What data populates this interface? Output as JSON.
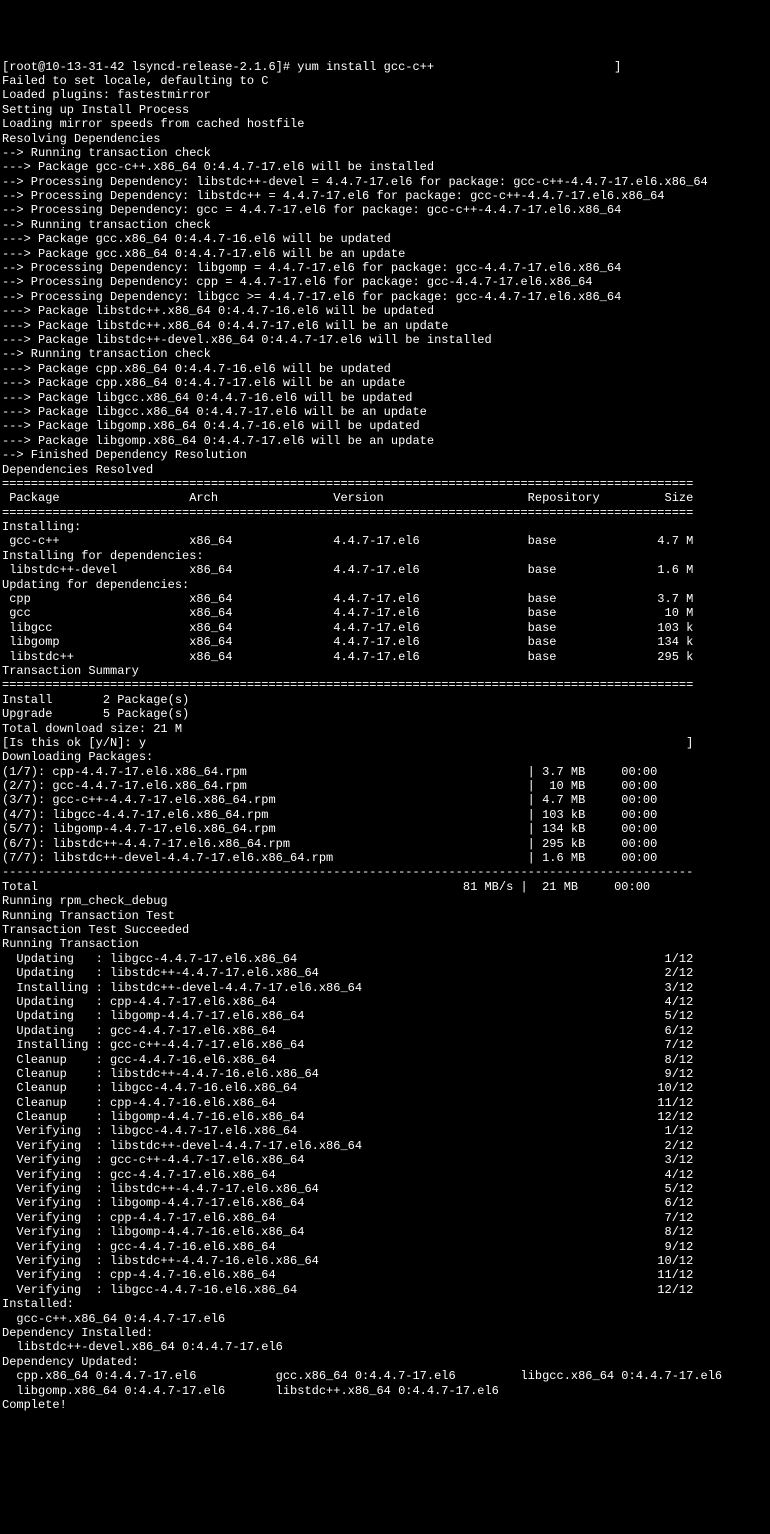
{
  "prompt": "[root@10-13-31-42 lsyncd-release-2.1.6]# yum install gcc-c++                         ]",
  "preLines": [
    "Failed to set locale, defaulting to C",
    "Loaded plugins: fastestmirror",
    "Setting up Install Process",
    "Loading mirror speeds from cached hostfile",
    "Resolving Dependencies",
    "--> Running transaction check",
    "---> Package gcc-c++.x86_64 0:4.4.7-17.el6 will be installed",
    "--> Processing Dependency: libstdc++-devel = 4.4.7-17.el6 for package: gcc-c++-4.4.7-17.el6.x86_64",
    "--> Processing Dependency: libstdc++ = 4.4.7-17.el6 for package: gcc-c++-4.4.7-17.el6.x86_64",
    "--> Processing Dependency: gcc = 4.4.7-17.el6 for package: gcc-c++-4.4.7-17.el6.x86_64",
    "--> Running transaction check",
    "---> Package gcc.x86_64 0:4.4.7-16.el6 will be updated",
    "---> Package gcc.x86_64 0:4.4.7-17.el6 will be an update",
    "--> Processing Dependency: libgomp = 4.4.7-17.el6 for package: gcc-4.4.7-17.el6.x86_64",
    "--> Processing Dependency: cpp = 4.4.7-17.el6 for package: gcc-4.4.7-17.el6.x86_64",
    "--> Processing Dependency: libgcc >= 4.4.7-17.el6 for package: gcc-4.4.7-17.el6.x86_64",
    "---> Package libstdc++.x86_64 0:4.4.7-16.el6 will be updated",
    "---> Package libstdc++.x86_64 0:4.4.7-17.el6 will be an update",
    "---> Package libstdc++-devel.x86_64 0:4.4.7-17.el6 will be installed",
    "--> Running transaction check",
    "---> Package cpp.x86_64 0:4.4.7-16.el6 will be updated",
    "---> Package cpp.x86_64 0:4.4.7-17.el6 will be an update",
    "---> Package libgcc.x86_64 0:4.4.7-16.el6 will be updated",
    "---> Package libgcc.x86_64 0:4.4.7-17.el6 will be an update",
    "---> Package libgomp.x86_64 0:4.4.7-16.el6 will be updated",
    "---> Package libgomp.x86_64 0:4.4.7-17.el6 will be an update",
    "--> Finished Dependency Resolution",
    "",
    "Dependencies Resolved",
    ""
  ],
  "separatorLine": "================================================================================================",
  "headerLine": " Package                  Arch                Version                    Repository         Size",
  "pkgSections": [
    {
      "title": "Installing:",
      "rows": [
        " gcc-c++                  x86_64              4.4.7-17.el6               base              4.7 M"
      ]
    },
    {
      "title": "Installing for dependencies:",
      "rows": [
        " libstdc++-devel          x86_64              4.4.7-17.el6               base              1.6 M"
      ]
    },
    {
      "title": "Updating for dependencies:",
      "rows": [
        " cpp                      x86_64              4.4.7-17.el6               base              3.7 M",
        " gcc                      x86_64              4.4.7-17.el6               base               10 M",
        " libgcc                   x86_64              4.4.7-17.el6               base              103 k",
        " libgomp                  x86_64              4.4.7-17.el6               base              134 k",
        " libstdc++                x86_64              4.4.7-17.el6               base              295 k"
      ]
    }
  ],
  "transactionSummaryTitle": "Transaction Summary",
  "summaryLines": [
    "Install       2 Package(s)",
    "Upgrade       5 Package(s)"
  ],
  "totalDownloadSize": "Total download size: 21 M",
  "isThisOk": "[Is this ok [y/N]: y                                                                           ]",
  "downloadingTitle": "Downloading Packages:",
  "downloads": [
    "(1/7): cpp-4.4.7-17.el6.x86_64.rpm                                       | 3.7 MB     00:00     ",
    "(2/7): gcc-4.4.7-17.el6.x86_64.rpm                                       |  10 MB     00:00     ",
    "(3/7): gcc-c++-4.4.7-17.el6.x86_64.rpm                                   | 4.7 MB     00:00     ",
    "(4/7): libgcc-4.4.7-17.el6.x86_64.rpm                                    | 103 kB     00:00     ",
    "(5/7): libgomp-4.4.7-17.el6.x86_64.rpm                                   | 134 kB     00:00     ",
    "(6/7): libstdc++-4.4.7-17.el6.x86_64.rpm                                 | 295 kB     00:00     ",
    "(7/7): libstdc++-devel-4.4.7-17.el6.x86_64.rpm                           | 1.6 MB     00:00     "
  ],
  "dashLine": "------------------------------------------------------------------------------------------------",
  "totalLine": "Total                                                           81 MB/s |  21 MB     00:00     ",
  "postDownloadLines": [
    "Running rpm_check_debug",
    "Running Transaction Test",
    "Transaction Test Succeeded",
    "Running Transaction"
  ],
  "transactionSteps": [
    "  Updating   : libgcc-4.4.7-17.el6.x86_64                                                   1/12 ",
    "  Updating   : libstdc++-4.4.7-17.el6.x86_64                                                2/12 ",
    "  Installing : libstdc++-devel-4.4.7-17.el6.x86_64                                          3/12 ",
    "  Updating   : cpp-4.4.7-17.el6.x86_64                                                      4/12 ",
    "  Updating   : libgomp-4.4.7-17.el6.x86_64                                                  5/12 ",
    "  Updating   : gcc-4.4.7-17.el6.x86_64                                                      6/12 ",
    "  Installing : gcc-c++-4.4.7-17.el6.x86_64                                                  7/12 ",
    "  Cleanup    : gcc-4.4.7-16.el6.x86_64                                                      8/12 ",
    "  Cleanup    : libstdc++-4.4.7-16.el6.x86_64                                                9/12 ",
    "  Cleanup    : libgcc-4.4.7-16.el6.x86_64                                                  10/12 ",
    "  Cleanup    : cpp-4.4.7-16.el6.x86_64                                                     11/12 ",
    "  Cleanup    : libgomp-4.4.7-16.el6.x86_64                                                 12/12 ",
    "  Verifying  : libgcc-4.4.7-17.el6.x86_64                                                   1/12 ",
    "  Verifying  : libstdc++-devel-4.4.7-17.el6.x86_64                                          2/12 ",
    "  Verifying  : gcc-c++-4.4.7-17.el6.x86_64                                                  3/12 ",
    "  Verifying  : gcc-4.4.7-17.el6.x86_64                                                      4/12 ",
    "  Verifying  : libstdc++-4.4.7-17.el6.x86_64                                                5/12 ",
    "  Verifying  : libgomp-4.4.7-17.el6.x86_64                                                  6/12 ",
    "  Verifying  : cpp-4.4.7-17.el6.x86_64                                                      7/12 ",
    "  Verifying  : libgomp-4.4.7-16.el6.x86_64                                                  8/12 ",
    "  Verifying  : gcc-4.4.7-16.el6.x86_64                                                      9/12 ",
    "  Verifying  : libstdc++-4.4.7-16.el6.x86_64                                               10/12 ",
    "  Verifying  : cpp-4.4.7-16.el6.x86_64                                                     11/12 ",
    "  Verifying  : libgcc-4.4.7-16.el6.x86_64                                                  12/12 "
  ],
  "installedTitle": "Installed:",
  "installedLine": "  gcc-c++.x86_64 0:4.4.7-17.el6                                                                 ",
  "depInstalledTitle": "Dependency Installed:",
  "depInstalledLine": "  libstdc++-devel.x86_64 0:4.4.7-17.el6                                                         ",
  "depUpdatedTitle": "Dependency Updated:",
  "depUpdatedLines": [
    "  cpp.x86_64 0:4.4.7-17.el6           gcc.x86_64 0:4.4.7-17.el6         libgcc.x86_64 0:4.4.7-17.el6",
    "  libgomp.x86_64 0:4.4.7-17.el6       libstdc++.x86_64 0:4.4.7-17.el6                               "
  ],
  "complete": "Complete!"
}
